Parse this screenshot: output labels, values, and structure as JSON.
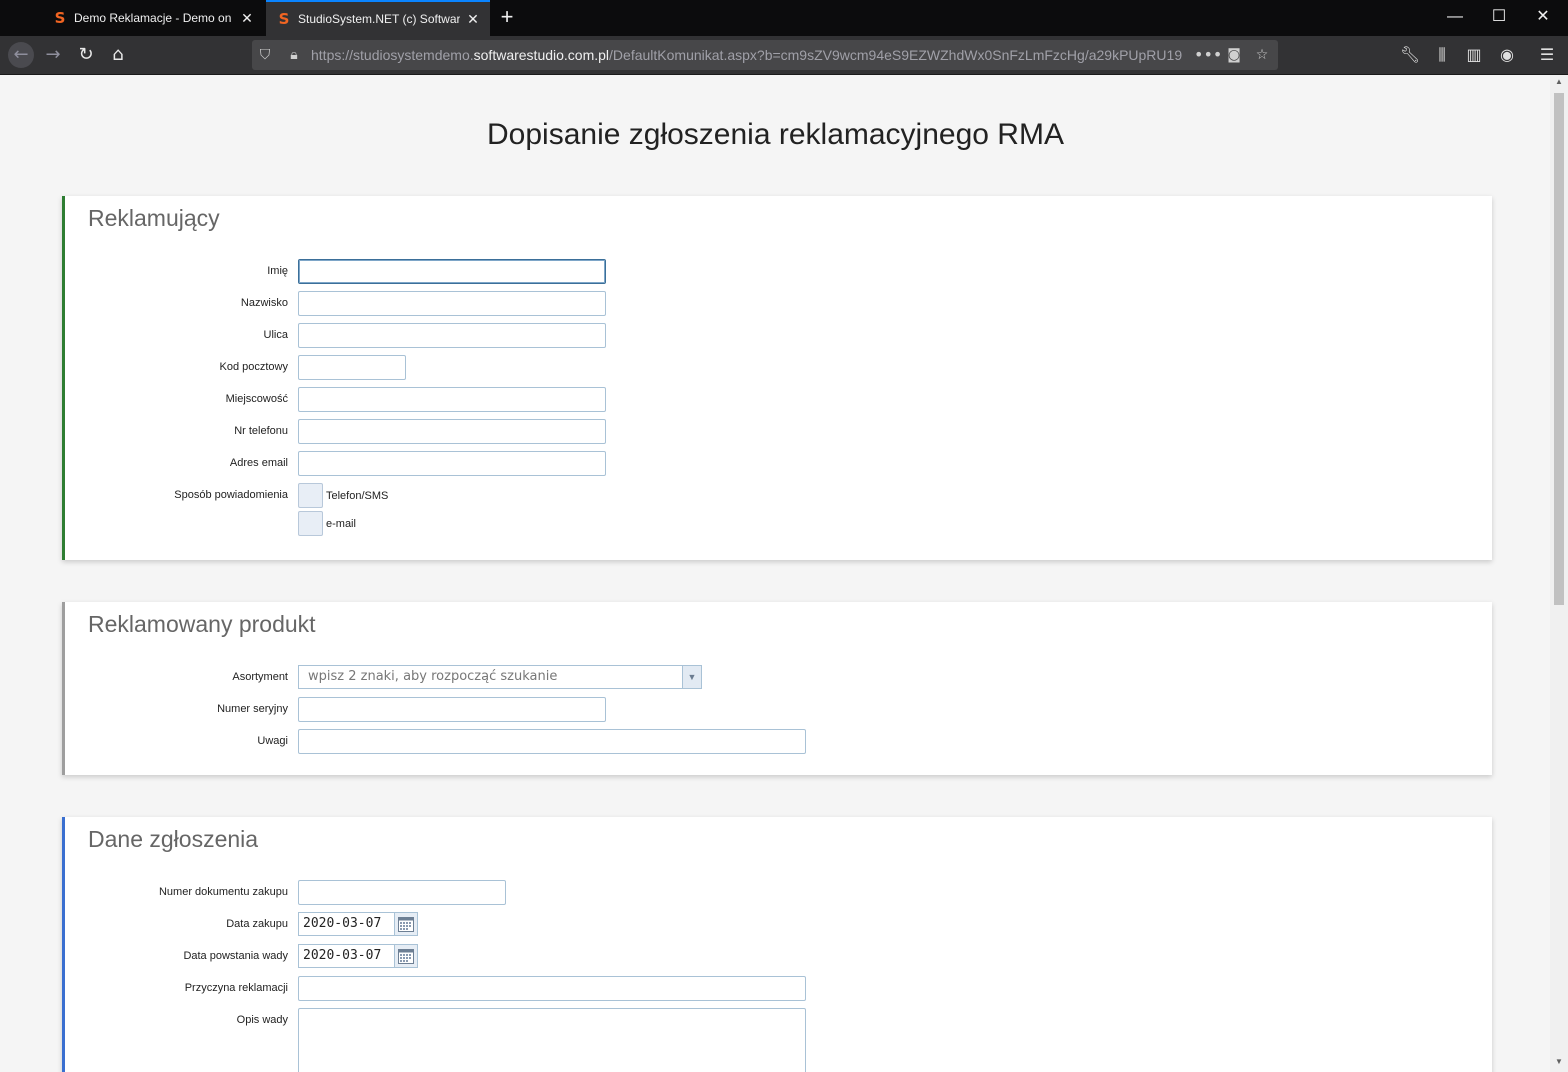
{
  "browser": {
    "tabs": [
      {
        "label": "Demo Reklamacje - Demo on li"
      },
      {
        "label": "StudioSystem.NET (c) Software"
      }
    ],
    "url": {
      "prefix": "https://studiosystemdemo.",
      "domain": "softwarestudio.com.pl",
      "path": "/DefaultKomunikat.aspx?b=cm9sZV9wcm94eS9EZWZhdWx0SnFzLmFzcHg/a29kPUpRU19"
    }
  },
  "page": {
    "title": "Dopisanie zgłoszenia reklamacyjnego RMA"
  },
  "reklamujacy": {
    "title": "Reklamujący",
    "imie": "Imię",
    "nazwisko": "Nazwisko",
    "ulica": "Ulica",
    "kod": "Kod pocztowy",
    "miejscowosc": "Miejscowość",
    "telefon": "Nr telefonu",
    "email": "Adres email",
    "sposob": "Sposób powiadomienia",
    "opt_tel": "Telefon/SMS",
    "opt_email": "e-mail"
  },
  "produkt": {
    "title": "Reklamowany produkt",
    "asortyment": "Asortyment",
    "asortyment_placeholder": "wpisz 2 znaki, aby rozpocząć szukanie",
    "numer": "Numer seryjny",
    "uwagi": "Uwagi"
  },
  "zgloszenie": {
    "title": "Dane zgłoszenia",
    "numer_dok": "Numer dokumentu zakupu",
    "data_zakupu": "Data zakupu",
    "data_zakupu_value": "2020-03-07",
    "data_wady": "Data powstania wady",
    "data_wady_value": "2020-03-07",
    "przyczyna": "Przyczyna reklamacji",
    "opis": "Opis wady"
  },
  "colors": {
    "panel1_accent": "#2e7d32",
    "panel2_accent": "#9e9e9e",
    "panel3_accent": "#3a6fd0"
  }
}
